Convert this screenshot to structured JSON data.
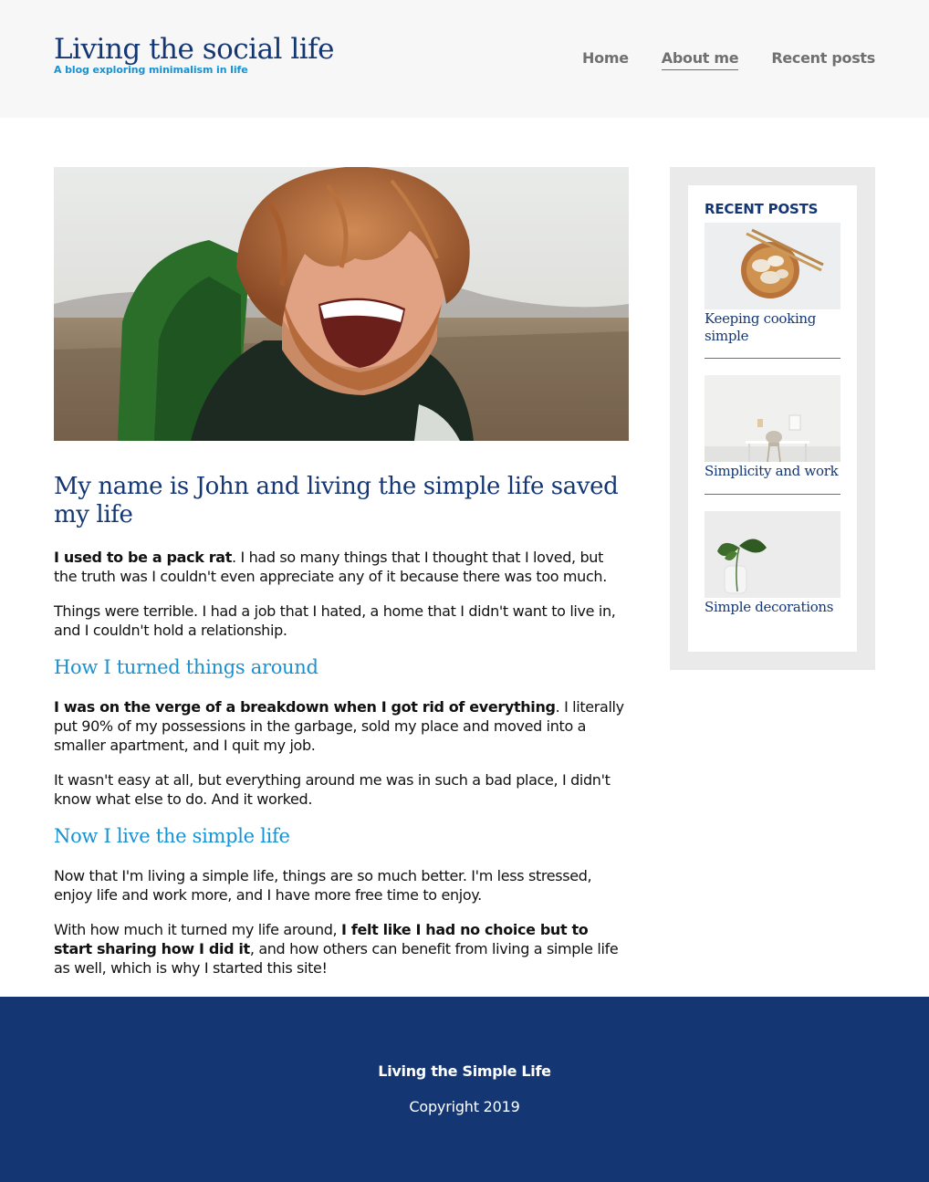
{
  "header": {
    "site_title": "Living the social life",
    "tagline": "A blog exploring minimalism in life",
    "nav": [
      {
        "label": "Home",
        "active": false
      },
      {
        "label": "About me",
        "active": true
      },
      {
        "label": "Recent posts",
        "active": false
      }
    ]
  },
  "hero": {
    "image_icon": "portrait-photo"
  },
  "article": {
    "title": "My name is John and living the simple life saved my life",
    "p1_bold": "I used to be a pack rat",
    "p1_rest": ". I had so many things that I thought that I loved, but the truth was I couldn't even appreciate any of it because there was too much.",
    "p2": "Things were terrible. I had a job that I hated, a home that I didn't want to live in, and I couldn't hold a relationship.",
    "h2_1": "How I turned things around",
    "p3_bold": "I was on the verge of a breakdown when I got rid of everything",
    "p3_rest": ". I literally put 90% of my possessions in the garbage, sold my place and moved into a smaller apartment, and I quit my job.",
    "p4": "It wasn't easy at all, but everything around me was in such a bad place, I didn't know what else to do. And it worked.",
    "h2_2": "Now I live the simple life",
    "p5": "Now that I'm living a simple life, things are so much better. I'm less stressed, enjoy life and work more, and I have more free time to enjoy.",
    "p6_start": "With how much it turned my life around, ",
    "p6_bold": "I felt like I had no choice but to start sharing how I did it",
    "p6_end": ", and how others can benefit from living a simple life as well, which is why I started this site!"
  },
  "sidebar": {
    "title": "Recent posts",
    "posts": [
      {
        "title": "Keeping cooking simple",
        "thumb_icon": "dumplings-photo"
      },
      {
        "title": "Simplicity and work",
        "thumb_icon": "desk-photo"
      },
      {
        "title": "Simple decorations",
        "thumb_icon": "plant-photo"
      }
    ]
  },
  "footer": {
    "title": "Living the Simple Life",
    "copyright": "Copyright 2019"
  },
  "colors": {
    "brand_navy": "#143774",
    "accent_blue": "#1792d2",
    "nav_gray": "#707070",
    "header_bg": "#f7f7f7",
    "sidebar_bg": "#eaeaea"
  }
}
